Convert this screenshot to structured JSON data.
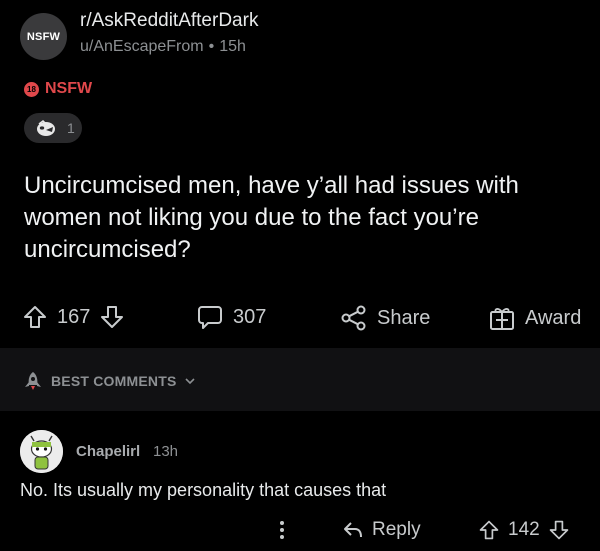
{
  "post": {
    "subreddit_icon_text": "NSFW",
    "subreddit": "r/AskRedditAfterDark",
    "author": "u/AnEscapeFrom",
    "separator": "•",
    "age": "15h",
    "nsfw_badge_number": "18",
    "nsfw_label": "NSFW",
    "award_count": "1",
    "title": "Uncircumcised men, have y’all had issues with women not liking you due to the fact you’re uncircumcised?",
    "upvotes": "167",
    "comments": "307",
    "share_label": "Share",
    "award_label": "Award"
  },
  "sort": {
    "label": "BEST COMMENTS"
  },
  "comment": {
    "author": "Chapelirl",
    "age": "13h",
    "body": "No. Its usually my personality that causes that",
    "reply_label": "Reply",
    "score": "142"
  },
  "colors": {
    "background": "#000000",
    "nsfw_red": "#e0484b",
    "muted_text": "#8d9093",
    "body_text": "#e8eaeb"
  },
  "icons": [
    "upvote-icon",
    "downvote-icon",
    "comment-bubble-icon",
    "share-icon",
    "gift-icon",
    "award-icon",
    "rocket-icon",
    "chevron-down-icon",
    "more-vertical-icon",
    "reply-arrow-icon"
  ]
}
